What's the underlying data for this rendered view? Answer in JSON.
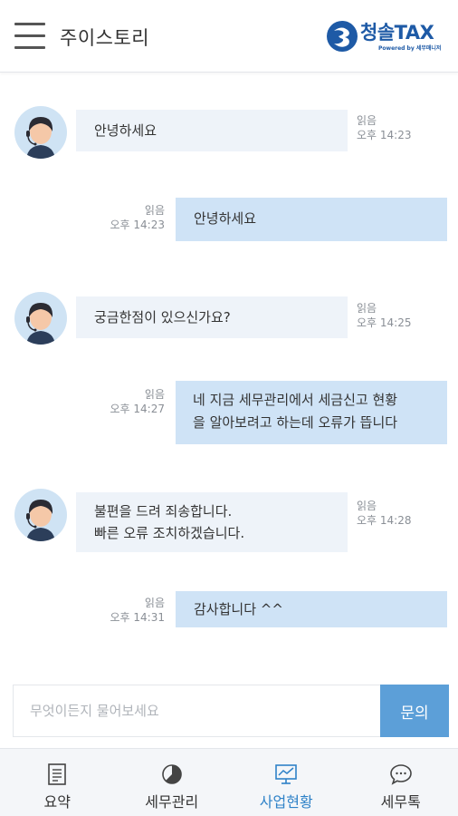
{
  "header": {
    "title": "주이스토리"
  },
  "logo": {
    "name": "청솔TAX",
    "sub": "Powered by 세무매니저"
  },
  "messages": [
    {
      "side": "in",
      "lines": [
        "안녕하세요"
      ],
      "read": "읽음",
      "time": "오후 14:23"
    },
    {
      "side": "out",
      "lines": [
        "안녕하세요"
      ],
      "read": "읽음",
      "time": "오후 14:23"
    },
    {
      "side": "in",
      "lines": [
        "궁금한점이 있으신가요?"
      ],
      "read": "읽음",
      "time": "오후 14:25"
    },
    {
      "side": "out",
      "lines": [
        "네 지금 세무관리에서 세금신고 현황",
        "을 알아보려고 하는데 오류가 뜹니다"
      ],
      "read": "읽음",
      "time": "오후 14:27"
    },
    {
      "side": "in",
      "lines": [
        "불편을 드려 죄송합니다.",
        "빠른 오류 조치하겠습니다."
      ],
      "read": "읽음",
      "time": "오후 14:28"
    },
    {
      "side": "out",
      "lines": [
        "감사합니다 ^^"
      ],
      "read": "읽음",
      "time": "오후 14:31"
    }
  ],
  "input": {
    "placeholder": "무엇이든지 물어보세요",
    "value": "",
    "send_label": "문의"
  },
  "nav": {
    "items": [
      {
        "label": "요약",
        "icon": "document-icon",
        "active": false
      },
      {
        "label": "세무관리",
        "icon": "pie-chart-icon",
        "active": false
      },
      {
        "label": "사업현황",
        "icon": "monitor-chart-icon",
        "active": true
      },
      {
        "label": "세무톡",
        "icon": "chat-bubble-icon",
        "active": false
      }
    ]
  },
  "colors": {
    "accent": "#5c9fd8",
    "brand": "#1e5aa6",
    "bubble_in": "#eef3f9",
    "bubble_out": "#cfe3f6",
    "active_nav": "#2f82c8"
  }
}
